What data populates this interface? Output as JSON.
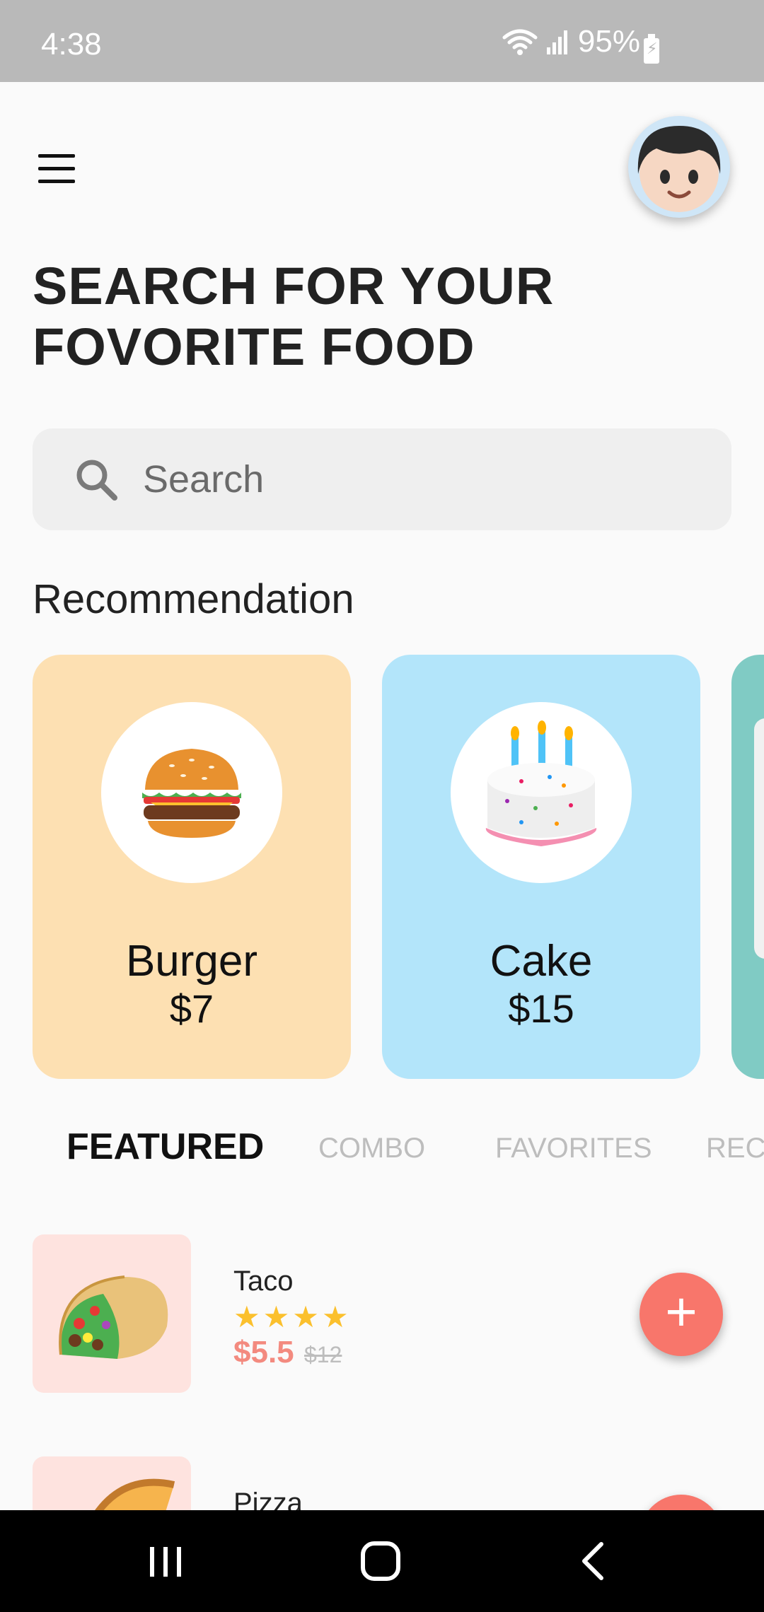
{
  "status_bar": {
    "time": "4:38",
    "battery": "95%"
  },
  "header": {
    "title_line1": "SEARCH FOR YOUR",
    "title_line2": "FOVORITE FOOD"
  },
  "search": {
    "placeholder": "Search"
  },
  "recommendation": {
    "title": "Recommendation",
    "cards": [
      {
        "name": "Burger",
        "price": "$7",
        "bg": "#fde0b2",
        "icon": "burger-icon"
      },
      {
        "name": "Cake",
        "price": "$15",
        "bg": "#b3e5fa",
        "icon": "cake-icon"
      },
      {
        "name": "",
        "price": "",
        "bg": "#80cbc4",
        "icon": ""
      }
    ]
  },
  "tabs": [
    "FEATURED",
    "COMBO",
    "FAVORITES",
    "RECO"
  ],
  "items": [
    {
      "name": "Taco",
      "stars": "★★★★",
      "price": "$5.5",
      "old_price": "$12",
      "icon": "taco-icon"
    },
    {
      "name": "Pizza",
      "icon": "pizza-icon"
    }
  ],
  "colors": {
    "accent": "#f8766b",
    "star": "#fbc02d",
    "price": "#f38a7f",
    "burger_card": "#fde0b2",
    "cake_card": "#b3e5fa",
    "third_card": "#80cbc4"
  }
}
